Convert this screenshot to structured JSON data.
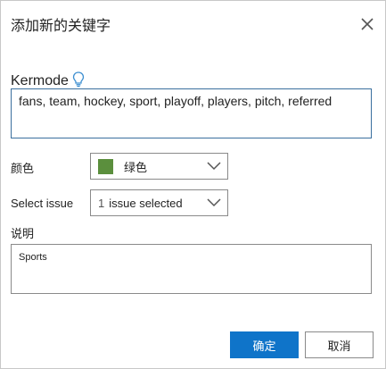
{
  "dialog": {
    "title": "添加新的关键字",
    "close_icon": "close-icon"
  },
  "keyword": {
    "label": "Kermode",
    "hint_icon": "lightbulb-icon",
    "value": "fans, team, hockey, sport, playoff, players, pitch, referred"
  },
  "color": {
    "label": "颜色",
    "selected": "绿色",
    "swatch": "#5b8f3d"
  },
  "issue": {
    "label": "Select issue",
    "count": "1",
    "selected": "issue selected"
  },
  "description": {
    "label": "说明",
    "value": "Sports"
  },
  "buttons": {
    "ok": "确定",
    "cancel": "取消"
  },
  "colors": {
    "accent": "#0f74c9",
    "focus_border": "#3a6f9e"
  }
}
